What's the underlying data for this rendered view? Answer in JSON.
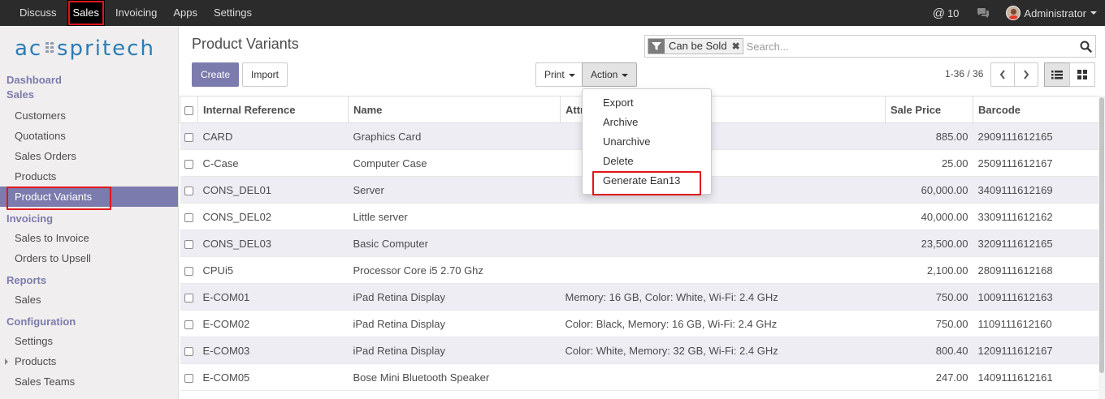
{
  "topbar": {
    "menu": [
      "Discuss",
      "Sales",
      "Invoicing",
      "Apps",
      "Settings"
    ],
    "active_menu": "Sales",
    "mentions_count": "10",
    "user_name": "Administrator"
  },
  "logo_text": "acuspritech",
  "sidebar": {
    "dashboard": "Dashboard",
    "sales_header": "Sales",
    "sales_items": [
      "Customers",
      "Quotations",
      "Sales Orders",
      "Products",
      "Product Variants"
    ],
    "invoicing_header": "Invoicing",
    "invoicing_items": [
      "Sales to Invoice",
      "Orders to Upsell"
    ],
    "reports_header": "Reports",
    "reports_items": [
      "Sales"
    ],
    "configuration_header": "Configuration",
    "configuration_items": [
      "Settings",
      "Products",
      "Sales Teams"
    ],
    "active_item": "Product Variants"
  },
  "page": {
    "title": "Product Variants",
    "create_label": "Create",
    "import_label": "Import",
    "print_label": "Print",
    "action_label": "Action",
    "pager": "1-36 / 36"
  },
  "search": {
    "facet_label": "Can be Sold",
    "placeholder": "Search..."
  },
  "action_menu": {
    "items": [
      "Export",
      "Archive",
      "Unarchive",
      "Delete",
      "Generate Ean13"
    ],
    "highlighted": "Generate Ean13"
  },
  "table": {
    "columns": [
      "Internal Reference",
      "Name",
      "Attribute Values",
      "Sale Price",
      "Barcode"
    ],
    "visible_header_text": [
      "Internal Reference",
      "Name",
      "Attr",
      "Sale Price",
      "Barcode"
    ],
    "rows": [
      {
        "ref": "CARD",
        "name": "Graphics Card",
        "attrs": "",
        "price": "885.00",
        "barcode": "2909111612165"
      },
      {
        "ref": "C-Case",
        "name": "Computer Case",
        "attrs": "",
        "price": "25.00",
        "barcode": "2509111612167"
      },
      {
        "ref": "CONS_DEL01",
        "name": "Server",
        "attrs": "",
        "price": "60,000.00",
        "barcode": "3409111612169"
      },
      {
        "ref": "CONS_DEL02",
        "name": "Little server",
        "attrs": "",
        "price": "40,000.00",
        "barcode": "3309111612162"
      },
      {
        "ref": "CONS_DEL03",
        "name": "Basic Computer",
        "attrs": "",
        "price": "23,500.00",
        "barcode": "3209111612165"
      },
      {
        "ref": "CPUi5",
        "name": "Processor Core i5 2.70 Ghz",
        "attrs": "",
        "price": "2,100.00",
        "barcode": "2809111612168"
      },
      {
        "ref": "E-COM01",
        "name": "iPad Retina Display",
        "attrs": "Memory: 16 GB, Color: White, Wi-Fi: 2.4 GHz",
        "price": "750.00",
        "barcode": "1009111612163"
      },
      {
        "ref": "E-COM02",
        "name": "iPad Retina Display",
        "attrs": "Color: Black, Memory: 16 GB, Wi-Fi: 2.4 GHz",
        "price": "750.00",
        "barcode": "1109111612160"
      },
      {
        "ref": "E-COM03",
        "name": "iPad Retina Display",
        "attrs": "Color: White, Memory: 32 GB, Wi-Fi: 2.4 GHz",
        "price": "800.40",
        "barcode": "1209111612167"
      },
      {
        "ref": "E-COM05",
        "name": "Bose Mini Bluetooth Speaker",
        "attrs": "",
        "price": "247.00",
        "barcode": "1409111612161"
      }
    ]
  },
  "colors": {
    "accent": "#7c7bad",
    "highlight_border": "#e0161b",
    "topbar_bg": "#2b2b2b",
    "odd_row_bg": "#eeedf4"
  },
  "icons": [
    "at-icon",
    "chat-icon",
    "avatar",
    "funnel-icon",
    "remove-icon",
    "search-icon",
    "chevron-left-icon",
    "chevron-right-icon",
    "list-view-icon",
    "kanban-view-icon",
    "caret-down-icon"
  ]
}
